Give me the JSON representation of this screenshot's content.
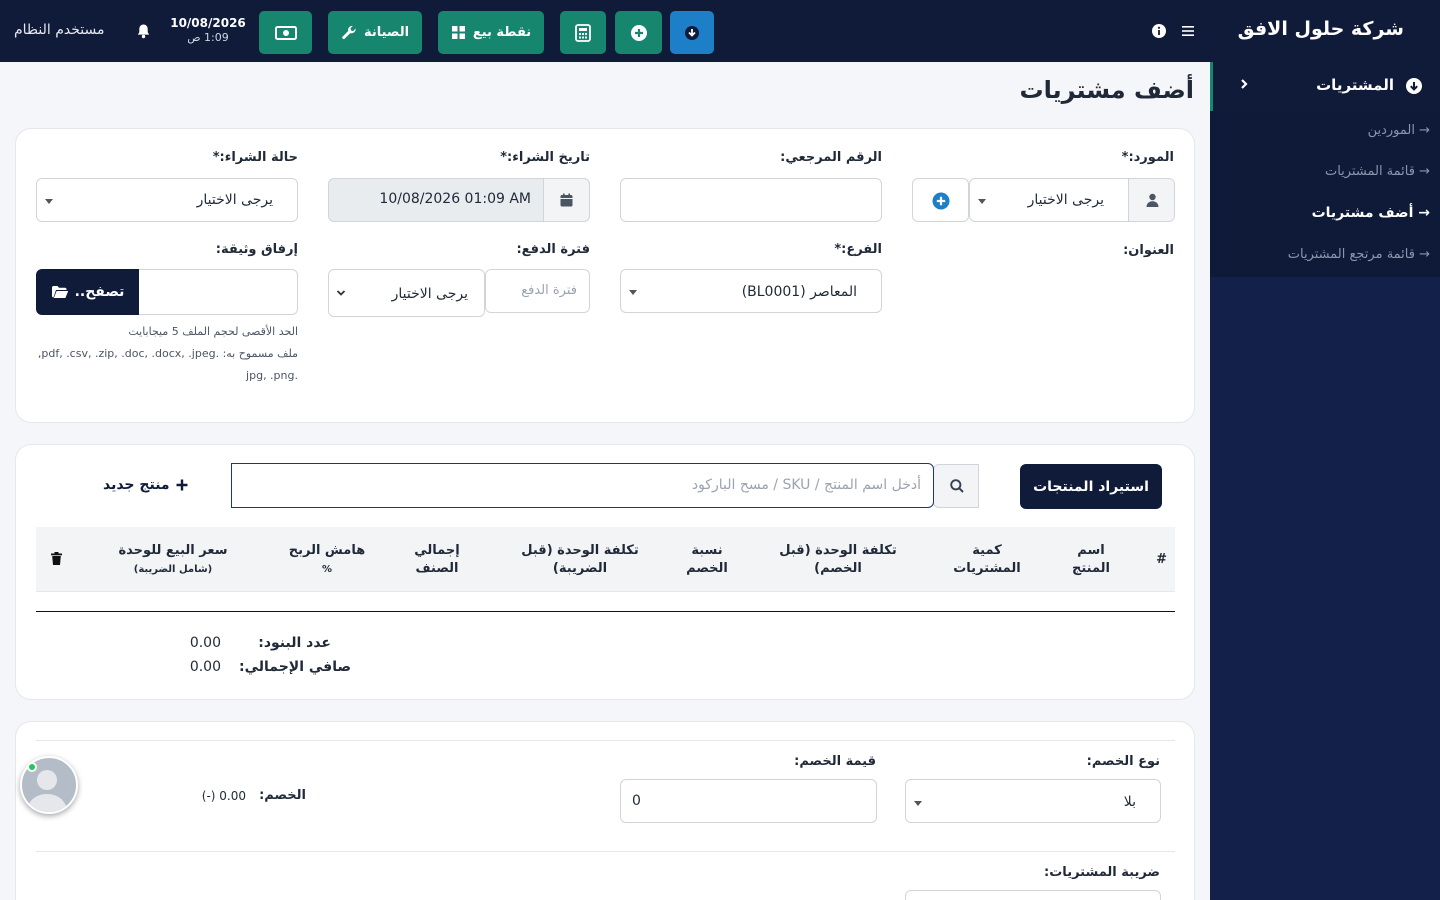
{
  "header": {
    "brand": "شركة حلول الافق",
    "date": "10/08/2026",
    "time": "1:09 ص",
    "user": "مستخدم النظام",
    "maintenance_label": "الصيانة",
    "pos_label": "نقطة بيع"
  },
  "sidebar": {
    "section_label": "المشتريات",
    "items": [
      {
        "label": "→ الموردين"
      },
      {
        "label": "→ قائمة المشتريات"
      },
      {
        "label": "→ أضف مشتريات"
      },
      {
        "label": "→ قائمة مرتجع المشتريات"
      }
    ]
  },
  "page": {
    "title": "أضف مشتريات"
  },
  "form": {
    "supplier_label": "المورد:*",
    "supplier_value": "يرجى الاختيار",
    "ref_label": "الرقم المرجعي:",
    "date_label": "تاريخ الشراء:*",
    "date_value": "10/08/2026 01:09 AM",
    "status_label": "حالة الشراء:*",
    "status_value": "يرجى الاختيار",
    "address_label": "العنوان:",
    "branch_label": "الفرع:*",
    "branch_value": "المعاصر (BL0001)",
    "pay_term_label": "فترة الدفع:",
    "pay_term_placeholder": "فترة الدفع",
    "pay_term_value": "يرجى الاختيار",
    "attach_label": "إرفاق وثيقة:",
    "browse_label": "تصفح..",
    "note_1": "الحد الأقصى لحجم الملف 5 ميجابايت",
    "note_2": "ملف مسموح به: .pdf, .csv, .zip, .doc, .docx, .jpeg,",
    "note_3": ".jpg, .png"
  },
  "products": {
    "import_label": "استيراد المنتجات",
    "search_placeholder": "أدخل اسم المنتج / SKU / مسح الباركود",
    "new_product_label": "منتج جديد",
    "columns": [
      "#",
      "اسم المنتج",
      "كمية المشتريات",
      "تكلفة الوحدة (قبل الخصم)",
      "نسبة الخصم",
      "تكلفة الوحدة (قبل الضريبة)",
      "إجمالي الصنف",
      "هامش الربح",
      "%",
      "سعر البيع للوحدة",
      "(شامل الضريبة)"
    ],
    "items_count_label": "عدد البنود:",
    "items_count_value": "0.00",
    "net_total_label": "صافي الإجمالي:",
    "net_total_value": "0.00"
  },
  "discount": {
    "type_label": "نوع الخصم:",
    "type_value": "بلا",
    "amount_label": "قيمة الخصم:",
    "amount_value": "0",
    "discount_label": "الخصم:",
    "discount_value": "(-) 0.00",
    "tax_label": "ضريبة المشتريات:"
  }
}
